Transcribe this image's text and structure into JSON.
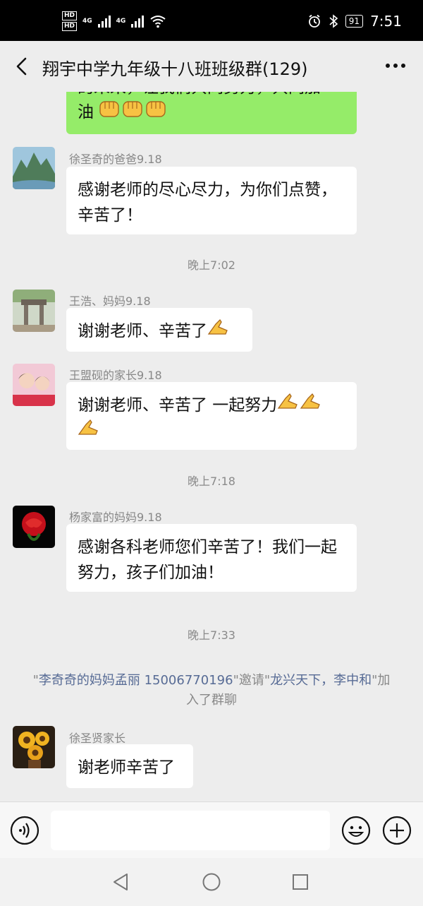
{
  "status_bar": {
    "hd1": "HD",
    "hd2": "HD",
    "net1": "4G",
    "net2": "4G",
    "battery": "91",
    "time": "7:51"
  },
  "header": {
    "title": "翔宇中学九年级十八班班级群(129)"
  },
  "messages": [
    {
      "sender": "",
      "text_line1": "的未来，让我们共同努力，共同加",
      "text_line2": "油",
      "self": true,
      "icon": "fist-emoji"
    },
    {
      "sender": "徐圣奇的爸爸9.18",
      "text": "感谢老师的尽心尽力，为你们点赞，辛苦了！",
      "avatar": "mountain-avatar"
    },
    {
      "time": "晚上7:02"
    },
    {
      "sender": "王浩、妈妈9.18",
      "text": "谢谢老师、辛苦了",
      "avatar": "gate-avatar",
      "icon": "ok-hand-emoji"
    },
    {
      "sender": "王盟砚的家长9.18",
      "text": "谢谢老师、辛苦了 一起努力",
      "avatar": "portrait-avatar",
      "icon": "ok-hand-emoji"
    },
    {
      "time": "晚上7:18"
    },
    {
      "sender": "杨家富的妈妈9.18",
      "text": "感谢各科老师您们辛苦了！我们一起努力，孩子们加油！",
      "avatar": "rose-avatar"
    },
    {
      "time": "晚上7:33"
    },
    {
      "system": {
        "q1": "\"",
        "inviter": "李奇奇的妈妈孟丽 15006770196",
        "q2": "\"",
        "verb": "邀请",
        "q3": "\"",
        "invitees": "龙兴天下，李中和",
        "q4": "\"",
        "suffix": "加入了群聊"
      }
    },
    {
      "sender": "徐圣贤家长",
      "text": "谢老师辛苦了",
      "avatar": "sunflower-avatar"
    }
  ],
  "input": {
    "placeholder": ""
  },
  "icons": {
    "back": "chevron-left-icon",
    "more": "more-dots-icon",
    "voice": "voice-icon",
    "emoji": "emoji-icon",
    "plus": "plus-icon",
    "nav_back": "nav-back-icon",
    "nav_home": "nav-home-icon",
    "nav_recent": "nav-recent-icon"
  },
  "colors": {
    "self_bubble": "#95ec69",
    "other_bubble": "#ffffff",
    "link": "#576b95",
    "background": "#ededed"
  }
}
